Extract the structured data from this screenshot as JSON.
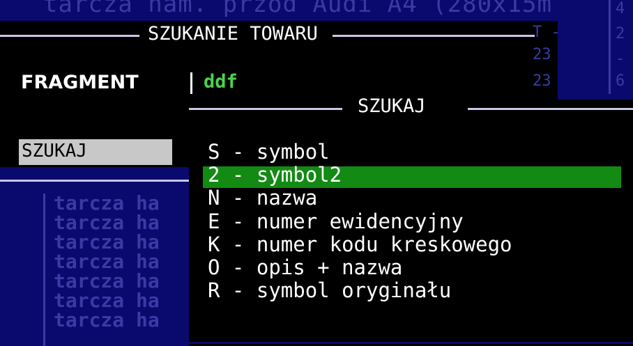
{
  "background": {
    "title_fragment": "tarcza ham. przód Audi A4 (280x15m",
    "right_col_a": [
      "T -",
      "23",
      "23"
    ],
    "right_col_b": [
      "4",
      "2",
      "-",
      "6"
    ],
    "list_items": [
      "tarcza ha",
      "tarcza ha",
      "tarcza ha",
      "tarcza ha",
      "tarcza ha",
      "tarcza ha",
      "tarcza ha"
    ]
  },
  "search_window": {
    "title": "SZUKANIE TOWARU",
    "field_label": "FRAGMENT",
    "field_value": "ddf",
    "button_label": "SZUKAJ"
  },
  "popup": {
    "title": "SZUKAJ",
    "items": [
      {
        "key": "S",
        "label": "symbol"
      },
      {
        "key": "2",
        "label": "symbol2"
      },
      {
        "key": "N",
        "label": "nazwa"
      },
      {
        "key": "E",
        "label": "numer ewidencyjny"
      },
      {
        "key": "K",
        "label": "numer kodu kreskowego"
      },
      {
        "key": "O",
        "label": "opis + nazwa"
      },
      {
        "key": "R",
        "label": "symbol oryginału"
      }
    ],
    "selected_index": 1
  },
  "colors": {
    "background": "#0a0a6e",
    "highlight": "#138a13",
    "input_text": "#4cd24c",
    "dim_text": "#3a3aa4"
  }
}
